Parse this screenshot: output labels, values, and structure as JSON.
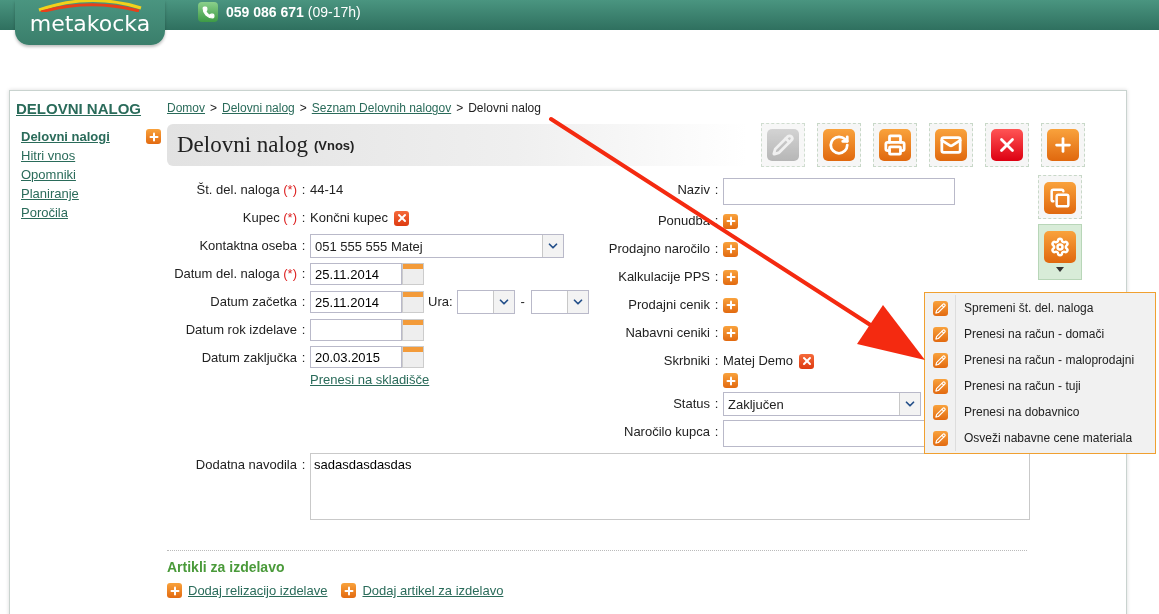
{
  "header": {
    "logo": "metakocka",
    "phone": "059 086 671",
    "hours": "(09-17h)"
  },
  "sidebar": {
    "title": "DELOVNI NALOG",
    "items": [
      {
        "label": "Delovni nalogi",
        "selected": true,
        "add": true
      },
      {
        "label": "Hitri vnos",
        "selected": false,
        "add": false
      },
      {
        "label": "Opomniki",
        "selected": false,
        "add": false
      },
      {
        "label": "Planiranje",
        "selected": false,
        "add": false
      },
      {
        "label": "Poročila",
        "selected": false,
        "add": false
      }
    ]
  },
  "breadcrumb": [
    {
      "label": "Domov",
      "link": true
    },
    {
      "label": "Delovni nalog",
      "link": true
    },
    {
      "label": "Seznam Delovnih nalogov",
      "link": true
    },
    {
      "label": "Delovni nalog",
      "link": false
    }
  ],
  "breadcrumb_separator": ">",
  "title": "Delovni nalog",
  "subtitle": "(Vnos)",
  "toolbar": [
    {
      "kind": "edit",
      "disabled": true
    },
    {
      "kind": "refresh",
      "disabled": false
    },
    {
      "kind": "print",
      "disabled": false
    },
    {
      "kind": "mail",
      "disabled": false
    },
    {
      "kind": "delete",
      "disabled": false
    },
    {
      "kind": "add",
      "disabled": false
    }
  ],
  "side_tools": [
    {
      "kind": "copy",
      "dropdown": false
    },
    {
      "kind": "settings",
      "dropdown": true
    }
  ],
  "left_fields": [
    {
      "label": "Št. del. naloga",
      "required_mark": "(*)",
      "kind": "text",
      "value": "44-14"
    },
    {
      "label": "Kupec",
      "required_mark": "(*)",
      "kind": "removable",
      "value": "Končni kupec"
    },
    {
      "label": "Kontaktna oseba",
      "kind": "select",
      "value": "051 555 555 Matej"
    },
    {
      "label": "Datum del. naloga",
      "required_mark": "(*)",
      "kind": "date",
      "value": "25.11.2014"
    },
    {
      "label": "Datum začetka",
      "kind": "datetime",
      "value": "25.11.2014",
      "time_label": "Ura:",
      "time_separator": "-"
    },
    {
      "label": "Datum rok izdelave",
      "kind": "date"
    },
    {
      "label": "Datum zaključka",
      "kind": "date",
      "value": "20.03.2015",
      "link": "Prenesi na skladišče"
    }
  ],
  "right_fields": [
    {
      "label": "Naziv",
      "kind": "input"
    },
    {
      "label": "Ponudba",
      "kind": "add"
    },
    {
      "label": "Prodajno naročilo",
      "kind": "add"
    },
    {
      "label": "Kalkulacije PPS",
      "kind": "add"
    },
    {
      "label": "Prodajni cenik",
      "kind": "add"
    },
    {
      "label": "Nabavni ceniki",
      "kind": "add"
    },
    {
      "label": "Skrbniki",
      "kind": "removable_add",
      "value": "Matej Demo"
    },
    {
      "label": "Status",
      "kind": "select",
      "value": "Zaključen"
    },
    {
      "label": "Naročilo kupca",
      "kind": "input"
    }
  ],
  "notes": {
    "label": "Dodatna navodila",
    "value": "sadasdasdasdas"
  },
  "field_separator": ":",
  "menu": [
    "Spremeni št. del. naloga",
    "Prenesi na račun - domači",
    "Prenesi na račun - maloprodajni",
    "Prenesi na račun - tuji",
    "Prenesi na dobavnico",
    "Osveži nabavne cene materiala"
  ],
  "section": {
    "title": "Artikli za izdelavo",
    "links": [
      "Dodaj relizacijo izdelave",
      "Dodaj artikel za izdelavo"
    ]
  }
}
